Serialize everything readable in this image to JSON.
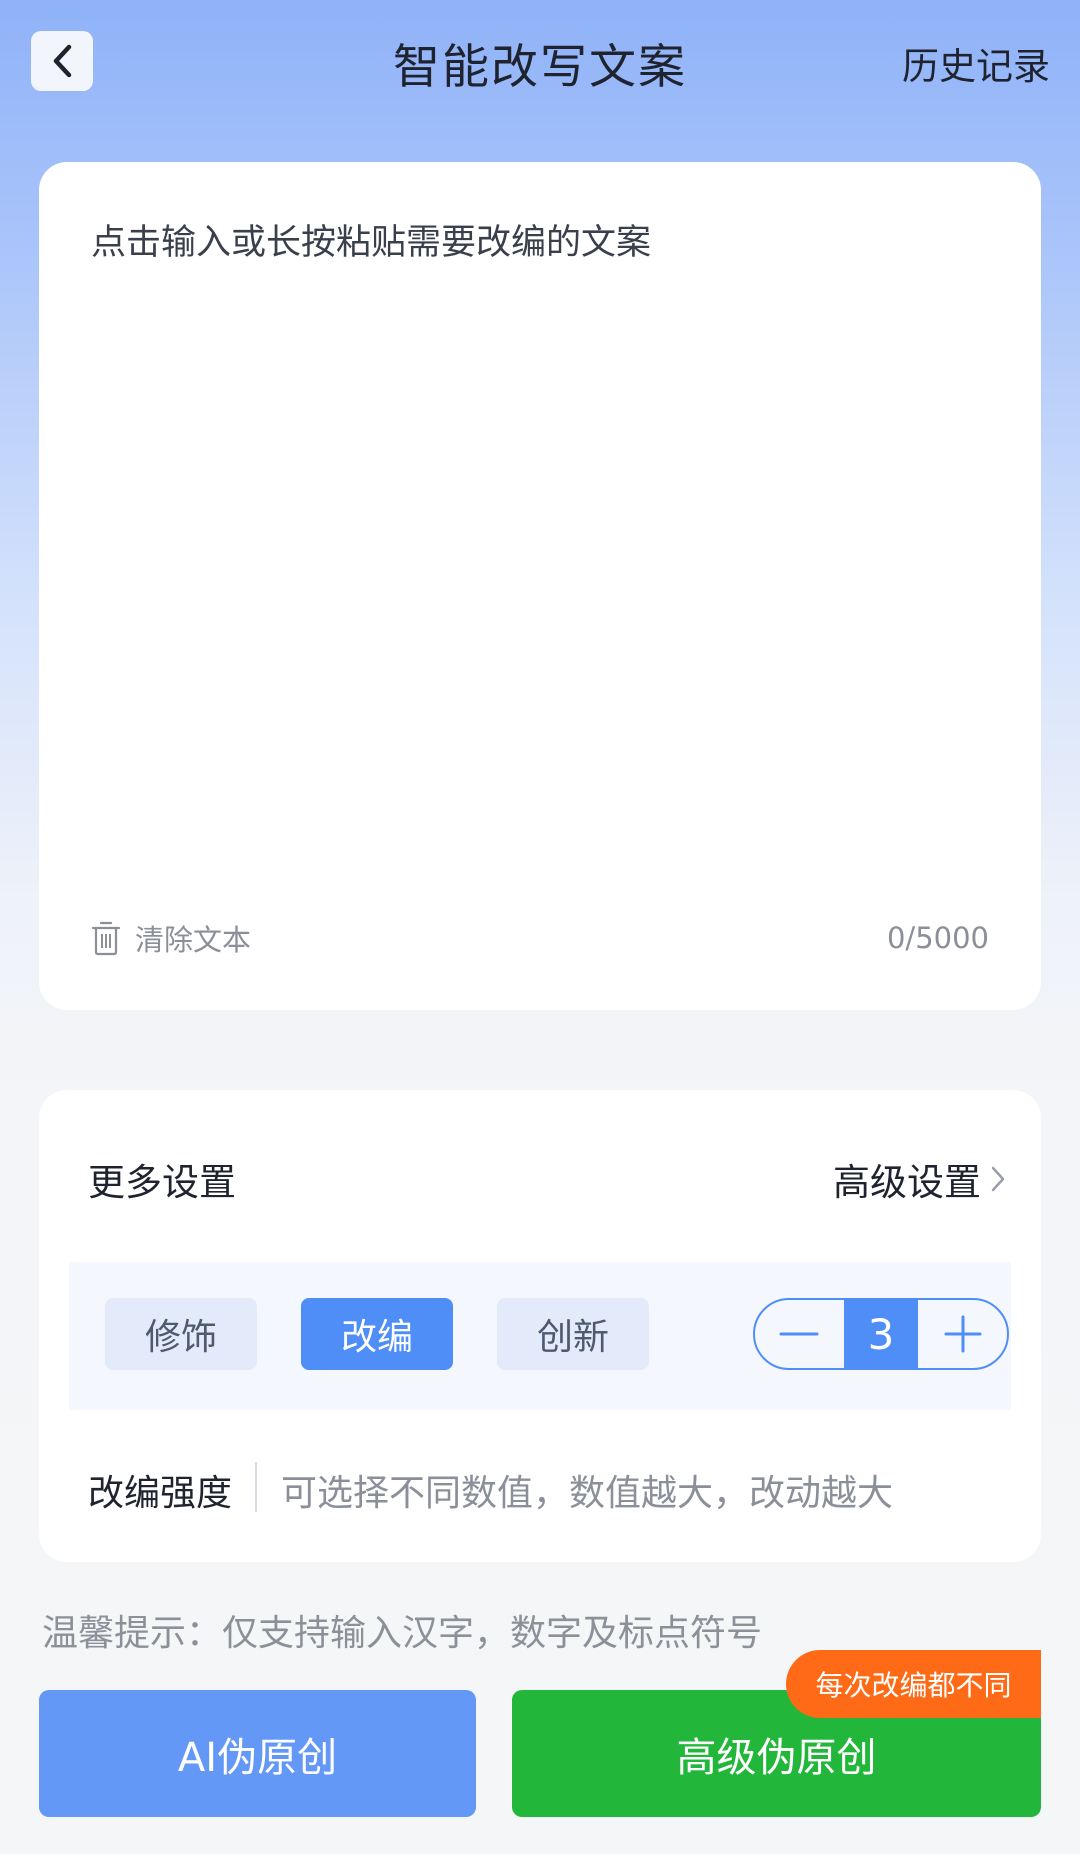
{
  "header": {
    "title": "智能改写文案",
    "history_label": "历史记录"
  },
  "input": {
    "placeholder": "点击输入或长按粘贴需要改编的文案",
    "value": "",
    "clear_label": "清除文本",
    "counter": "0/5000"
  },
  "settings": {
    "title": "更多设置",
    "advanced_label": "高级设置",
    "modes": [
      {
        "label": "修饰",
        "active": false
      },
      {
        "label": "改编",
        "active": true
      },
      {
        "label": "创新",
        "active": false
      }
    ],
    "stepper_value": "3",
    "strength_label": "改编强度",
    "strength_hint": "可选择不同数值，数值越大，改动越大"
  },
  "tip": "温馨提示：仅支持输入汉字，数字及标点符号",
  "buttons": {
    "ai_label": "AI伪原创",
    "pro_label": "高级伪原创",
    "badge": "每次改编都不同"
  },
  "colors": {
    "accent": "#4f8ef7",
    "ai_button": "#6398f6",
    "pro_button": "#22b73b",
    "badge": "#ff6a16"
  }
}
